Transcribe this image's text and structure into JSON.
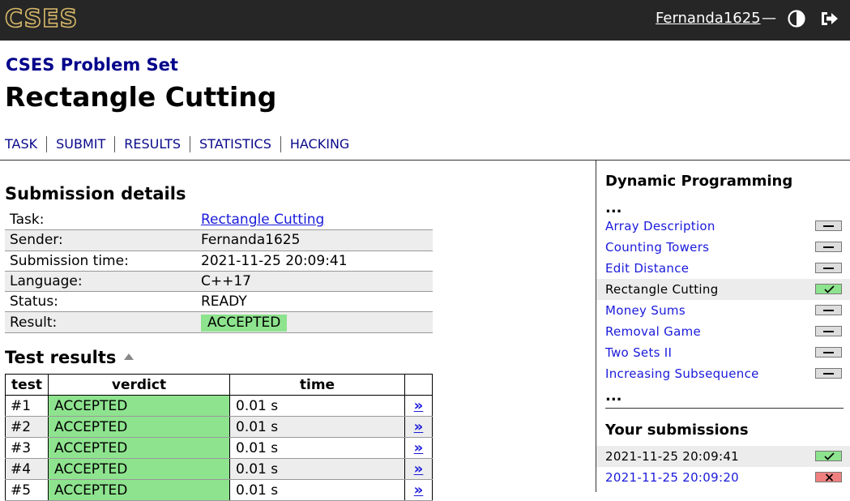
{
  "header": {
    "logo_text": "CSES",
    "username": "Fernanda1625",
    "separator": "—",
    "icons": [
      "half-circle-theme-icon",
      "logout-icon"
    ]
  },
  "problem_set_title": "CSES Problem Set",
  "page_title": "Rectangle Cutting",
  "nav_tabs": [
    "TASK",
    "SUBMIT",
    "RESULTS",
    "STATISTICS",
    "HACKING"
  ],
  "submission_details": {
    "heading": "Submission details",
    "rows": [
      {
        "label": "Task:",
        "value": "Rectangle Cutting"
      },
      {
        "label": "Sender:",
        "value": "Fernanda1625"
      },
      {
        "label": "Submission time:",
        "value": "2021-11-25 20:09:41"
      },
      {
        "label": "Language:",
        "value": "C++17"
      },
      {
        "label": "Status:",
        "value": "READY"
      },
      {
        "label": "Result:",
        "value": "ACCEPTED"
      }
    ]
  },
  "test_results": {
    "heading": "Test results",
    "columns": [
      "test",
      "verdict",
      "time"
    ],
    "rows": [
      {
        "test": "#1",
        "verdict": "ACCEPTED",
        "time": "0.01 s",
        "link": "»"
      },
      {
        "test": "#2",
        "verdict": "ACCEPTED",
        "time": "0.01 s",
        "link": "»"
      },
      {
        "test": "#3",
        "verdict": "ACCEPTED",
        "time": "0.01 s",
        "link": "»"
      },
      {
        "test": "#4",
        "verdict": "ACCEPTED",
        "time": "0.01 s",
        "link": "»"
      },
      {
        "test": "#5",
        "verdict": "ACCEPTED",
        "time": "0.01 s",
        "link": "»"
      }
    ]
  },
  "sidebar": {
    "title": "Dynamic Programming",
    "ellipsis": "...",
    "items": [
      {
        "label": "Array Description",
        "status": "none"
      },
      {
        "label": "Counting Towers",
        "status": "none"
      },
      {
        "label": "Edit Distance",
        "status": "none"
      },
      {
        "label": "Rectangle Cutting",
        "status": "accepted"
      },
      {
        "label": "Money Sums",
        "status": "none"
      },
      {
        "label": "Removal Game",
        "status": "none"
      },
      {
        "label": "Two Sets II",
        "status": "none"
      },
      {
        "label": "Increasing Subsequence",
        "status": "none"
      }
    ],
    "submissions_title": "Your submissions",
    "submissions": [
      {
        "label": "2021-11-25 20:09:41",
        "status": "accepted"
      },
      {
        "label": "2021-11-25 20:09:20",
        "status": "rejected"
      }
    ]
  }
}
